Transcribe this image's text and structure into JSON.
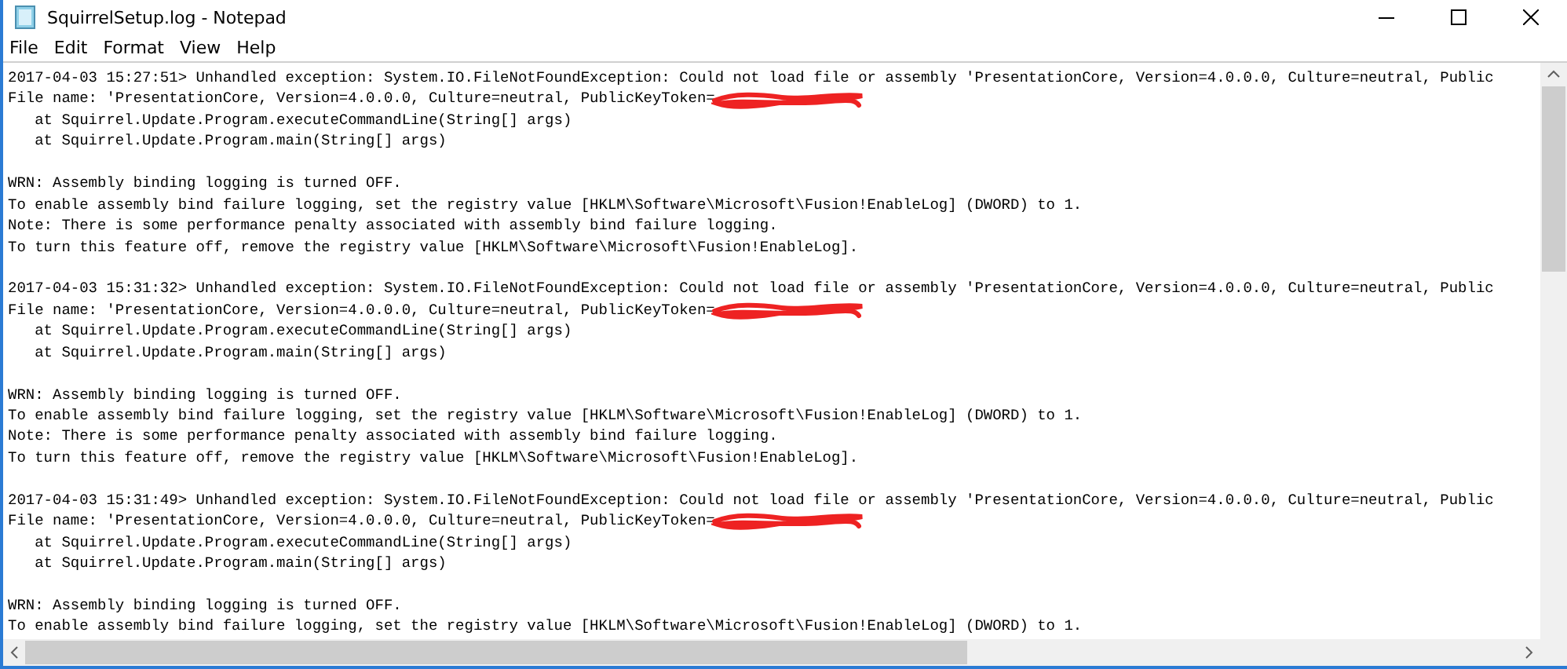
{
  "window": {
    "title": "SquirrelSetup.log - Notepad"
  },
  "menu": [
    "File",
    "Edit",
    "Format",
    "View",
    "Help"
  ],
  "lines": [
    {
      "kind": "text",
      "text": "2017-04-03 15:27:51> Unhandled exception: System.IO.FileNotFoundException: Could not load file or assembly 'PresentationCore, Version=4.0.0.0, Culture=neutral, Public"
    },
    {
      "kind": "redacted",
      "text": "File name: 'PresentationCore, Version=4.0.0.0, Culture=neutral, PublicKeyToken="
    },
    {
      "kind": "text",
      "text": "   at Squirrel.Update.Program.executeCommandLine(String[] args)"
    },
    {
      "kind": "text",
      "text": "   at Squirrel.Update.Program.main(String[] args)"
    },
    {
      "kind": "blank"
    },
    {
      "kind": "text",
      "text": "WRN: Assembly binding logging is turned OFF."
    },
    {
      "kind": "text",
      "text": "To enable assembly bind failure logging, set the registry value [HKLM\\Software\\Microsoft\\Fusion!EnableLog] (DWORD) to 1."
    },
    {
      "kind": "text",
      "text": "Note: There is some performance penalty associated with assembly bind failure logging."
    },
    {
      "kind": "text",
      "text": "To turn this feature off, remove the registry value [HKLM\\Software\\Microsoft\\Fusion!EnableLog]."
    },
    {
      "kind": "blank"
    },
    {
      "kind": "text",
      "text": "2017-04-03 15:31:32> Unhandled exception: System.IO.FileNotFoundException: Could not load file or assembly 'PresentationCore, Version=4.0.0.0, Culture=neutral, Public"
    },
    {
      "kind": "redacted",
      "text": "File name: 'PresentationCore, Version=4.0.0.0, Culture=neutral, PublicKeyToken="
    },
    {
      "kind": "text",
      "text": "   at Squirrel.Update.Program.executeCommandLine(String[] args)"
    },
    {
      "kind": "text",
      "text": "   at Squirrel.Update.Program.main(String[] args)"
    },
    {
      "kind": "blank"
    },
    {
      "kind": "text",
      "text": "WRN: Assembly binding logging is turned OFF."
    },
    {
      "kind": "text",
      "text": "To enable assembly bind failure logging, set the registry value [HKLM\\Software\\Microsoft\\Fusion!EnableLog] (DWORD) to 1."
    },
    {
      "kind": "text",
      "text": "Note: There is some performance penalty associated with assembly bind failure logging."
    },
    {
      "kind": "text",
      "text": "To turn this feature off, remove the registry value [HKLM\\Software\\Microsoft\\Fusion!EnableLog]."
    },
    {
      "kind": "blank"
    },
    {
      "kind": "text",
      "text": "2017-04-03 15:31:49> Unhandled exception: System.IO.FileNotFoundException: Could not load file or assembly 'PresentationCore, Version=4.0.0.0, Culture=neutral, Public"
    },
    {
      "kind": "redacted",
      "text": "File name: 'PresentationCore, Version=4.0.0.0, Culture=neutral, PublicKeyToken="
    },
    {
      "kind": "text",
      "text": "   at Squirrel.Update.Program.executeCommandLine(String[] args)"
    },
    {
      "kind": "text",
      "text": "   at Squirrel.Update.Program.main(String[] args)"
    },
    {
      "kind": "blank"
    },
    {
      "kind": "text",
      "text": "WRN: Assembly binding logging is turned OFF."
    },
    {
      "kind": "text",
      "text": "To enable assembly bind failure logging, set the registry value [HKLM\\Software\\Microsoft\\Fusion!EnableLog] (DWORD) to 1."
    }
  ]
}
